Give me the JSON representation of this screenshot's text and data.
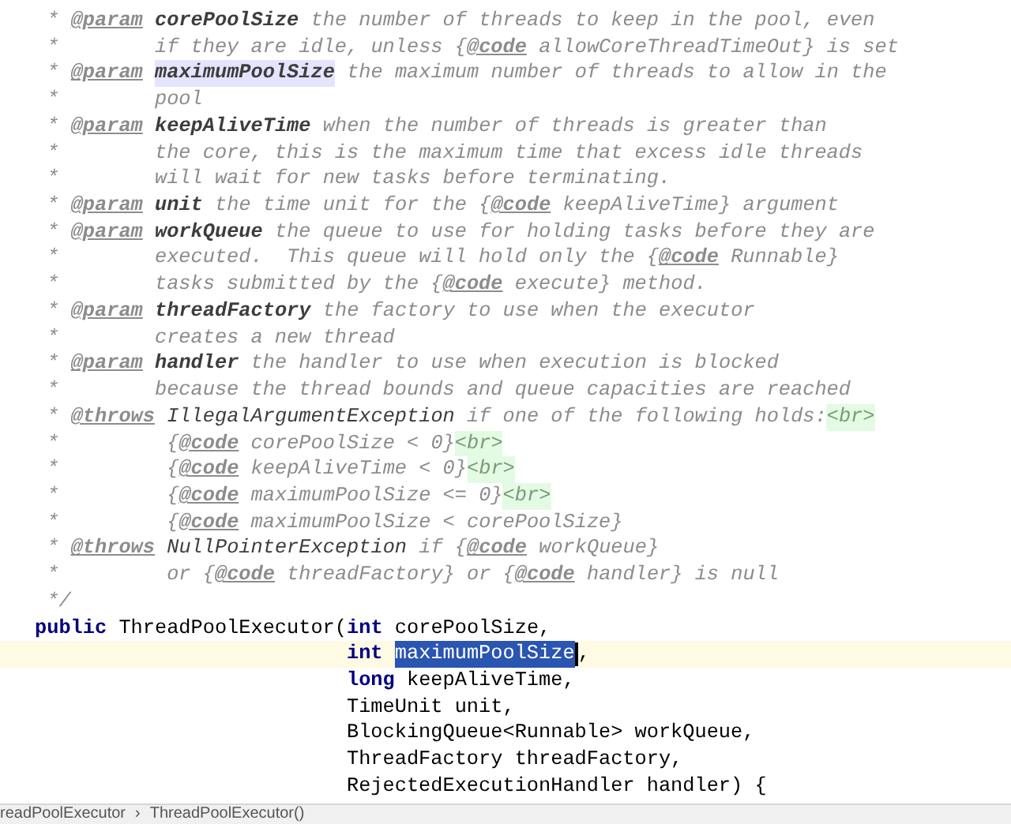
{
  "lines": [
    {
      "parts": [
        {
          "kind": "star",
          "text": " *"
        },
        {
          "kind": "tag",
          "text": " @param"
        },
        {
          "kind": "param",
          "text": " corePoolSize"
        },
        {
          "kind": "text",
          "text": " the number of threads to keep in the pool, even"
        }
      ]
    },
    {
      "parts": [
        {
          "kind": "star",
          "text": " *"
        },
        {
          "kind": "text",
          "text": "        if they are idle, unless {"
        },
        {
          "kind": "code",
          "text": "@code"
        },
        {
          "kind": "text",
          "text": " allowCoreThreadTimeOut} is set"
        }
      ]
    },
    {
      "parts": [
        {
          "kind": "star",
          "text": " *"
        },
        {
          "kind": "tag",
          "text": " @param"
        },
        {
          "kind": "mark",
          "text": " maximumPoolSize"
        },
        {
          "kind": "text",
          "text": " the maximum number of threads to allow in the"
        }
      ]
    },
    {
      "parts": [
        {
          "kind": "star",
          "text": " *"
        },
        {
          "kind": "text",
          "text": "        pool"
        }
      ]
    },
    {
      "parts": [
        {
          "kind": "star",
          "text": " *"
        },
        {
          "kind": "tag",
          "text": " @param"
        },
        {
          "kind": "param",
          "text": " keepAliveTime"
        },
        {
          "kind": "text",
          "text": " when the number of threads is greater than"
        }
      ]
    },
    {
      "parts": [
        {
          "kind": "star",
          "text": " *"
        },
        {
          "kind": "text",
          "text": "        the core, this is the maximum time that excess idle threads"
        }
      ]
    },
    {
      "parts": [
        {
          "kind": "star",
          "text": " *"
        },
        {
          "kind": "text",
          "text": "        will wait for new tasks before terminating."
        }
      ]
    },
    {
      "parts": [
        {
          "kind": "star",
          "text": " *"
        },
        {
          "kind": "tag",
          "text": " @param"
        },
        {
          "kind": "param",
          "text": " unit"
        },
        {
          "kind": "text",
          "text": " the time unit for the {"
        },
        {
          "kind": "code",
          "text": "@code"
        },
        {
          "kind": "text",
          "text": " keepAliveTime} argument"
        }
      ]
    },
    {
      "parts": [
        {
          "kind": "star",
          "text": " *"
        },
        {
          "kind": "tag",
          "text": " @param"
        },
        {
          "kind": "param",
          "text": " workQueue"
        },
        {
          "kind": "text",
          "text": " the queue to use for holding tasks before they are"
        }
      ]
    },
    {
      "parts": [
        {
          "kind": "star",
          "text": " *"
        },
        {
          "kind": "text",
          "text": "        executed.  This queue will hold only the {"
        },
        {
          "kind": "code",
          "text": "@code"
        },
        {
          "kind": "text",
          "text": " Runnable}"
        }
      ]
    },
    {
      "parts": [
        {
          "kind": "star",
          "text": " *"
        },
        {
          "kind": "text",
          "text": "        tasks submitted by the {"
        },
        {
          "kind": "code",
          "text": "@code"
        },
        {
          "kind": "text",
          "text": " execute} method."
        }
      ]
    },
    {
      "parts": [
        {
          "kind": "star",
          "text": " *"
        },
        {
          "kind": "tag",
          "text": " @param"
        },
        {
          "kind": "param",
          "text": " threadFactory"
        },
        {
          "kind": "text",
          "text": " the factory to use when the executor"
        }
      ]
    },
    {
      "parts": [
        {
          "kind": "star",
          "text": " *"
        },
        {
          "kind": "text",
          "text": "        creates a new thread"
        }
      ]
    },
    {
      "parts": [
        {
          "kind": "star",
          "text": " *"
        },
        {
          "kind": "tag",
          "text": " @param"
        },
        {
          "kind": "param",
          "text": " handler"
        },
        {
          "kind": "text",
          "text": " the handler to use when execution is blocked"
        }
      ]
    },
    {
      "parts": [
        {
          "kind": "star",
          "text": " *"
        },
        {
          "kind": "text",
          "text": "        because the thread bounds and queue capacities are reached"
        }
      ]
    },
    {
      "parts": [
        {
          "kind": "star",
          "text": " *"
        },
        {
          "kind": "tag",
          "text": " @throws"
        },
        {
          "kind": "ref",
          "text": " IllegalArgumentException"
        },
        {
          "kind": "text",
          "text": " if one of the following holds:"
        },
        {
          "kind": "html",
          "text": "<br>"
        }
      ]
    },
    {
      "parts": [
        {
          "kind": "star",
          "text": " *"
        },
        {
          "kind": "text",
          "text": "         {"
        },
        {
          "kind": "code",
          "text": "@code"
        },
        {
          "kind": "text",
          "text": " corePoolSize < 0}"
        },
        {
          "kind": "html",
          "text": "<br>"
        }
      ]
    },
    {
      "parts": [
        {
          "kind": "star",
          "text": " *"
        },
        {
          "kind": "text",
          "text": "         {"
        },
        {
          "kind": "code",
          "text": "@code"
        },
        {
          "kind": "text",
          "text": " keepAliveTime < 0}"
        },
        {
          "kind": "html",
          "text": "<br>"
        }
      ]
    },
    {
      "parts": [
        {
          "kind": "star",
          "text": " *"
        },
        {
          "kind": "text",
          "text": "         {"
        },
        {
          "kind": "code",
          "text": "@code"
        },
        {
          "kind": "text",
          "text": " maximumPoolSize <= 0}"
        },
        {
          "kind": "html",
          "text": "<br>"
        }
      ]
    },
    {
      "parts": [
        {
          "kind": "star",
          "text": " *"
        },
        {
          "kind": "text",
          "text": "         {"
        },
        {
          "kind": "code",
          "text": "@code"
        },
        {
          "kind": "text",
          "text": " maximumPoolSize < corePoolSize}"
        }
      ]
    },
    {
      "parts": [
        {
          "kind": "star",
          "text": " *"
        },
        {
          "kind": "tag",
          "text": " @throws"
        },
        {
          "kind": "ref",
          "text": " NullPointerException"
        },
        {
          "kind": "text",
          "text": " if {"
        },
        {
          "kind": "code",
          "text": "@code"
        },
        {
          "kind": "text",
          "text": " workQueue}"
        }
      ]
    },
    {
      "parts": [
        {
          "kind": "star",
          "text": " *"
        },
        {
          "kind": "text",
          "text": "         or {"
        },
        {
          "kind": "code",
          "text": "@code"
        },
        {
          "kind": "text",
          "text": " threadFactory} or {"
        },
        {
          "kind": "code",
          "text": "@code"
        },
        {
          "kind": "text",
          "text": " handler} is null"
        }
      ]
    },
    {
      "parts": [
        {
          "kind": "star",
          "text": " */"
        }
      ]
    },
    {
      "parts": [
        {
          "kind": "kw",
          "text": "public"
        },
        {
          "kind": "plain",
          "text": " ThreadPoolExecutor("
        },
        {
          "kind": "kw",
          "text": "int"
        },
        {
          "kind": "plain",
          "text": " corePoolSize,"
        }
      ]
    },
    {
      "current": true,
      "parts": [
        {
          "kind": "kw",
          "text": "                          int"
        },
        {
          "kind": "sel",
          "text": " maximumPoolSize"
        },
        {
          "kind": "caret"
        },
        {
          "kind": "plain",
          "text": ","
        }
      ]
    },
    {
      "parts": [
        {
          "kind": "kw",
          "text": "                          long"
        },
        {
          "kind": "plain",
          "text": " keepAliveTime,"
        }
      ]
    },
    {
      "parts": [
        {
          "kind": "plain",
          "text": "                          TimeUnit unit,"
        }
      ]
    },
    {
      "parts": [
        {
          "kind": "plain",
          "text": "                          BlockingQueue<Runnable> workQueue,"
        }
      ]
    },
    {
      "parts": [
        {
          "kind": "plain",
          "text": "                          ThreadFactory threadFactory,"
        }
      ]
    },
    {
      "parts": [
        {
          "kind": "plain",
          "text": "                          RejectedExecutionHandler handler) {"
        }
      ]
    }
  ],
  "status_bar": {
    "breadcrumbs": [
      "readPoolExecutor",
      "ThreadPoolExecutor()"
    ],
    "separator": "›"
  }
}
